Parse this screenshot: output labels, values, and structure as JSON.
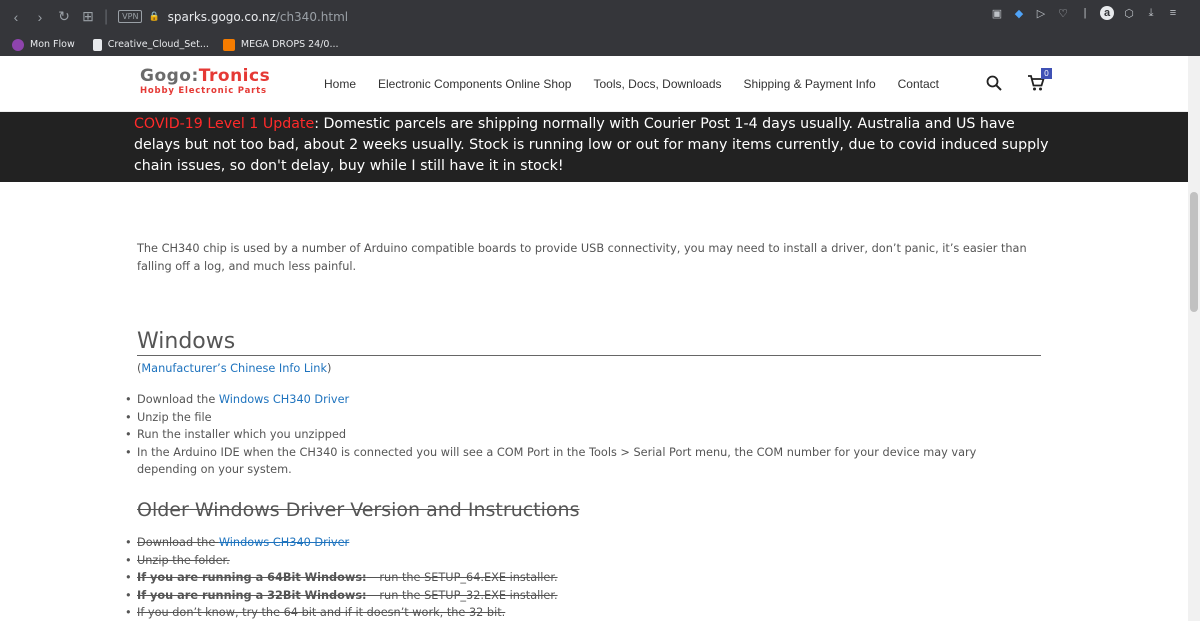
{
  "browser": {
    "url_host": "sparks.gogo.co.nz",
    "url_path": "/ch340.html",
    "vpn_label": "VPN",
    "bookmarks": [
      {
        "label": "Mon Flow",
        "color": "#8e44ad"
      },
      {
        "label": "Creative_Cloud_Set...",
        "color": "#e8eaed"
      },
      {
        "label": "MEGA DROPS 24/0...",
        "color": "#f57c00"
      }
    ]
  },
  "site": {
    "logo_part1": "Gogo:",
    "logo_part2": "Tronics",
    "logo_sub": "Hobby Electronic Parts",
    "nav": [
      "Home",
      "Electronic Components Online Shop",
      "Tools, Docs, Downloads",
      "Shipping & Payment Info",
      "Contact"
    ],
    "cart_count": "0"
  },
  "banner": {
    "alert": "COVID-19 Level 1 Update",
    "text": ": Domestic parcels are shipping normally with Courier Post 1-4 days usually. Australia and US have delays but not too bad, about 2 weeks usually. Stock is running low or out for many items currently, due to covid induced supply chain issues, so don't delay, buy while I still have it in stock!"
  },
  "content": {
    "intro": "The CH340 chip is used by a number of Arduino compatible boards to provide USB connectivity, you may need to install a driver, don’t panic, it’s easier than falling off a log, and much less painful.",
    "windows_heading": "Windows",
    "mfr_open": "(",
    "mfr_link": "Manufacturer’s Chinese Info Link",
    "mfr_close": ")",
    "list1": {
      "item1_pre": "Download the ",
      "item1_link": "Windows CH340 Driver",
      "item2": "Unzip the file",
      "item3": "Run the installer which you unzipped",
      "item4": "In the Arduino IDE when the CH340 is connected you will see a COM Port in the Tools > Serial Port menu, the COM number for your device may vary depending on your system."
    },
    "older_heading": "Older Windows Driver Version and Instructions",
    "list2": {
      "item1_pre": "Download the ",
      "item1_link": "Windows CH340 Driver",
      "item2": "Unzip the folder.",
      "item3_bold": "If you are running a 64Bit Windows:",
      "item3_rest": " – run the SETUP_64.EXE installer.",
      "item4_bold": "If you are running a 32Bit Windows:",
      "item4_rest": " – run the SETUP_32.EXE installer.",
      "item5": "If you don’t know, try the 64 bit and if it doesn’t work, the 32 bit."
    }
  }
}
